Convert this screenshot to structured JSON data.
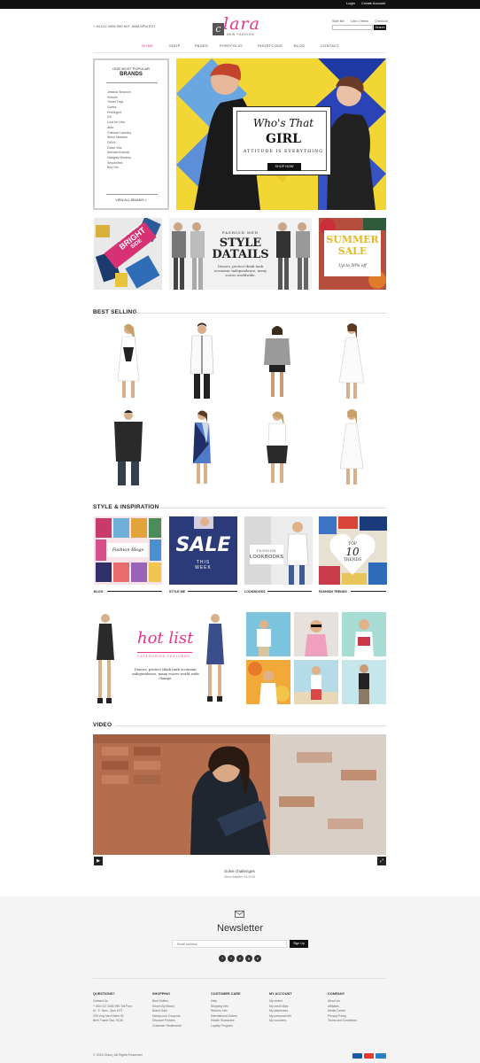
{
  "topbar": {
    "login": "Login",
    "create_account": "Create Account"
  },
  "header": {
    "contact": "+ 84 012 3456 999   M-F: 8AM-5PM EST",
    "logo_word": "lara",
    "logo_letter": "c",
    "logo_tagline": "NEW FASHION",
    "links": [
      "Style Me",
      "Cart: 0 Items",
      "Checkout"
    ],
    "search_button": "Search"
  },
  "nav": [
    "HOME",
    "SHOP",
    "PAGES",
    "PORTFOLIO",
    "SHORTCODE",
    "BLOG",
    "CONTACT"
  ],
  "brands": {
    "subtitle": "OUR MOST POPULAR",
    "title": "BRANDS",
    "items": [
      "Jessica Simpson",
      "Schultz",
      "Tinker Toys",
      "Guess",
      "Privileged",
      "GX",
      "Lord for Ulla",
      "Aldo",
      "Chinese Laundry",
      "Steve Madden",
      "DKNY",
      "Dolce Vita",
      "Michael Antonio",
      "Naughty Monkey",
      "Seychelles",
      "Bed Stu"
    ],
    "view_all": "VIEW ALL BRANDS >"
  },
  "hero": {
    "title_line1": "Who's That",
    "title_line2": "GIRL",
    "tagline": "ATTITUDE IS EVERYTHING",
    "button": "SHOP NOW"
  },
  "promos": {
    "bright_line1": "LOOK ON THE",
    "bright_line2": "BRIGHT",
    "bright_line3": "SIDE",
    "style_kicker": "FASHION MEN",
    "style_title1": "STYLE",
    "style_title2": "DATAILS",
    "style_desc": "Donors, protect think tank economic independence, many voices worldwide.",
    "summer1": "SUMMER",
    "summer2": "SALE",
    "summer_off": "Up to 50% off"
  },
  "best_selling": {
    "title": "BEST SELLING"
  },
  "inspiration": {
    "title": "STYLE & INSPIRATION",
    "blog_img_text": "Fashion Blogs",
    "sale_big": "SALE",
    "sale_small1": "THIS",
    "sale_small2": "WEEK",
    "lookbook_small": "FASHION",
    "lookbook_big": "LOOKBOOKS",
    "top10_a": "TOP",
    "top10_b": "10",
    "top10_c": "TRENDS",
    "labels": [
      "BLOG",
      "STYLE ME",
      "LOOKBOOKS",
      "FASHION TRENDS"
    ]
  },
  "hotlist": {
    "title": "hot list",
    "subtitle": "CATEGORIES FEATURED",
    "desc": "Donors, protect think tank economic independence, many voices world wide change."
  },
  "video": {
    "title": "VIDEO",
    "caption": "Solve challenges",
    "caption_sub": "Steve Madden $129.99",
    "play_icon": "play-icon",
    "expand_icon": "expand-icon"
  },
  "newsletter": {
    "title": "Newsletter",
    "placeholder": "Email address",
    "button": "Sign Up",
    "social": [
      "f",
      "t",
      "y",
      "g",
      "p"
    ]
  },
  "footer": {
    "columns": [
      {
        "title": "QUESTIONS?",
        "items": [
          "Contact Us",
          "+ 084 012 3456 999 Toll Free",
          "M - F: 9am - 5pm EST",
          "299 Ung Van Khiem St,",
          "Binh Thanh Dist, HCM"
        ]
      },
      {
        "title": "SHOPPING",
        "items": [
          "Best Sellers",
          "Shoes By Brand",
          "Brand Sale",
          "Handy.com Coupons",
          "Discount Policies",
          "Customer Testimonial"
        ]
      },
      {
        "title": "CUSTOMER CARE",
        "items": [
          "Help",
          "Shipping Info",
          "Returns Info",
          "International Orders",
          "Health Guarantee",
          "Loyalty Program"
        ]
      },
      {
        "title": "MY ACCOUNT",
        "items": [
          "My orders",
          "My credit slips",
          "My addresses",
          "My personal info",
          "My vouchers"
        ]
      },
      {
        "title": "COMPANY",
        "items": [
          "About Us",
          "Affiliates",
          "Media Center",
          "Privacy Policy",
          "Terms and Conditions"
        ]
      }
    ],
    "copyright": "© 2016 Clara  |  All Rights Reserved",
    "payment_colors": [
      "#1a5aa8",
      "#e33b2e",
      "#2b7fc0",
      "#f2f2f2"
    ]
  },
  "colors": {
    "accent": "#e6358a",
    "dark": "#111111"
  }
}
